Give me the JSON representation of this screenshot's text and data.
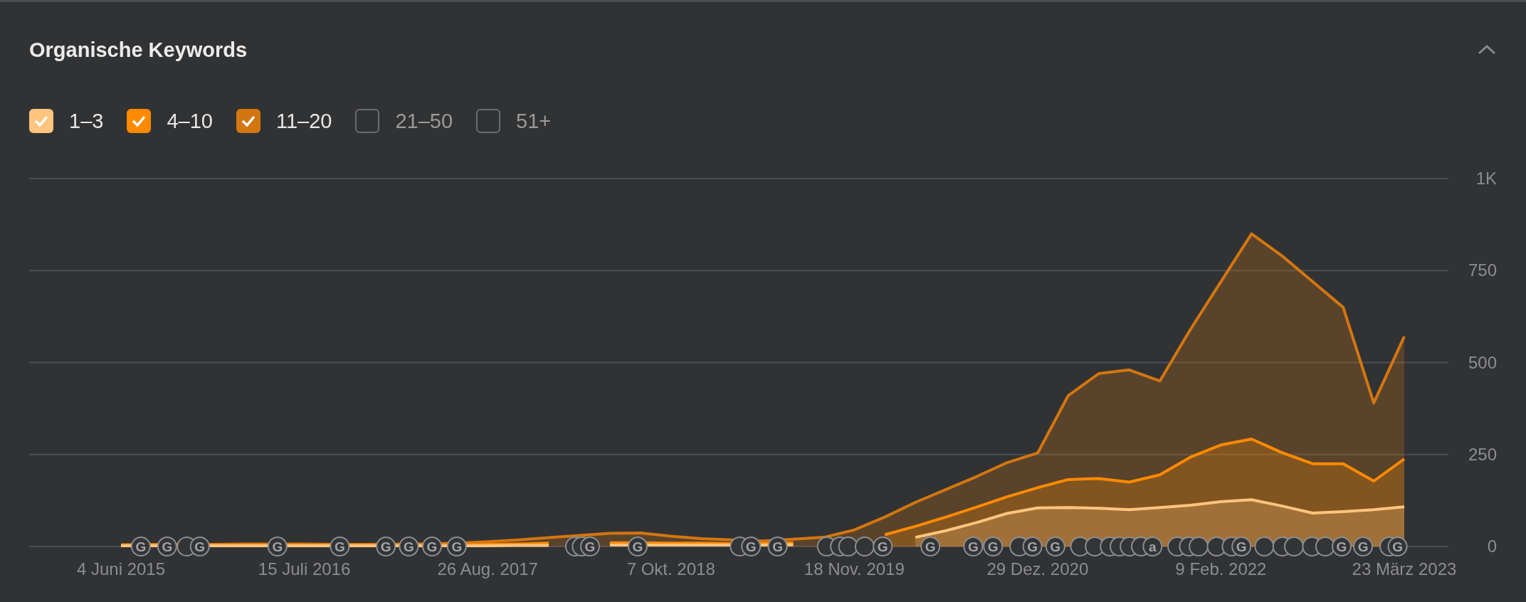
{
  "panel": {
    "title": "Organische Keywords",
    "collapsed": false
  },
  "legend": [
    {
      "label": "1–3",
      "checked": true,
      "color": "#ffc47e"
    },
    {
      "label": "4–10",
      "checked": true,
      "color": "#ff8a00"
    },
    {
      "label": "11–20",
      "checked": true,
      "color": "#d4760f"
    },
    {
      "label": "21–50",
      "checked": false
    },
    {
      "label": "51+",
      "checked": false
    }
  ],
  "chart_data": {
    "type": "area",
    "stacked": false,
    "grid": true,
    "ylim": [
      0,
      1000
    ],
    "categories": [
      "4 Juni 2015",
      null,
      null,
      null,
      null,
      null,
      "15 Juli 2016",
      null,
      null,
      null,
      null,
      null,
      "26 Aug. 2017",
      null,
      null,
      null,
      null,
      null,
      "7 Okt. 2018",
      null,
      null,
      null,
      null,
      null,
      "18 Nov. 2019",
      null,
      null,
      null,
      null,
      null,
      "29 Dez. 2020",
      null,
      null,
      null,
      null,
      null,
      "9 Feb. 2022",
      null,
      null,
      null,
      null,
      null,
      "23 März 2023"
    ],
    "series": [
      {
        "color": "#d4760f",
        "values": [
          5,
          6,
          6,
          6,
          7,
          7,
          7,
          6,
          6,
          7,
          7,
          9,
          13,
          18,
          24,
          30,
          36,
          37,
          28,
          21,
          18,
          15,
          20,
          25,
          45,
          80,
          120,
          155,
          190,
          228,
          254,
          410,
          470,
          480,
          450,
          590,
          720,
          850,
          790,
          720,
          650,
          390,
          571
        ]
      },
      {
        "color": "#ff8a00",
        "values": [
          4,
          4,
          4,
          4,
          4,
          4,
          4,
          4,
          4,
          4,
          5,
          5,
          6,
          7,
          9,
          null,
          10,
          10,
          9,
          9,
          8,
          8,
          10,
          null,
          null,
          32,
          55,
          80,
          107,
          135,
          160,
          182,
          185,
          175,
          195,
          243,
          276,
          292,
          255,
          225,
          225,
          178,
          238
        ]
      },
      {
        "color": "#ffc47e",
        "values": [
          2,
          2,
          2,
          2,
          2,
          2,
          2,
          2,
          2,
          2,
          2,
          2,
          2,
          3,
          3,
          null,
          4,
          4,
          4,
          4,
          4,
          4,
          5,
          null,
          null,
          null,
          25,
          43,
          65,
          90,
          105,
          106,
          104,
          100,
          106,
          112,
          122,
          127,
          110,
          91,
          95,
          100,
          108
        ]
      }
    ],
    "yticks": [
      0,
      250,
      500,
      750,
      {
        "value": 1000,
        "label": "1K"
      }
    ]
  },
  "update_markers": [
    {
      "kind": "letter",
      "text": "G"
    },
    {
      "kind": "letter",
      "text": "G"
    },
    {
      "kind": "ring"
    },
    {
      "kind": "letter",
      "text": "G"
    },
    {
      "kind": "letter",
      "text": "G"
    },
    {
      "kind": "letter",
      "text": "G"
    },
    {
      "kind": "letter",
      "text": "G"
    },
    {
      "kind": "letter",
      "text": "G"
    },
    {
      "kind": "letter",
      "text": "G"
    },
    {
      "kind": "letter",
      "text": "G"
    },
    {
      "kind": "ring"
    },
    {
      "kind": "ring"
    },
    {
      "kind": "letter",
      "text": "G"
    },
    {
      "kind": "letter",
      "text": "G"
    },
    {
      "kind": "ring"
    },
    {
      "kind": "letter",
      "text": "G"
    },
    {
      "kind": "letter",
      "text": "G"
    },
    {
      "kind": "ring"
    },
    {
      "kind": "ring"
    },
    {
      "kind": "ring"
    },
    {
      "kind": "ring"
    },
    {
      "kind": "letter",
      "text": "G"
    },
    {
      "kind": "letter",
      "text": "G"
    },
    {
      "kind": "letter",
      "text": "G"
    },
    {
      "kind": "letter",
      "text": "G"
    },
    {
      "kind": "ring"
    },
    {
      "kind": "letter",
      "text": "G"
    },
    {
      "kind": "letter",
      "text": "G"
    },
    {
      "kind": "ring"
    },
    {
      "kind": "ring"
    },
    {
      "kind": "ring"
    },
    {
      "kind": "ring"
    },
    {
      "kind": "ring"
    },
    {
      "kind": "ring"
    },
    {
      "kind": "letter",
      "text": "a"
    },
    {
      "kind": "ring"
    },
    {
      "kind": "ring"
    },
    {
      "kind": "ring"
    },
    {
      "kind": "ring"
    },
    {
      "kind": "ring"
    },
    {
      "kind": "letter",
      "text": "G"
    },
    {
      "kind": "ring"
    },
    {
      "kind": "ring"
    },
    {
      "kind": "ring"
    },
    {
      "kind": "ring"
    },
    {
      "kind": "ring"
    },
    {
      "kind": "letter",
      "text": "G"
    },
    {
      "kind": "letter",
      "text": "G"
    },
    {
      "kind": "ring"
    },
    {
      "kind": "letter",
      "text": "G"
    }
  ]
}
